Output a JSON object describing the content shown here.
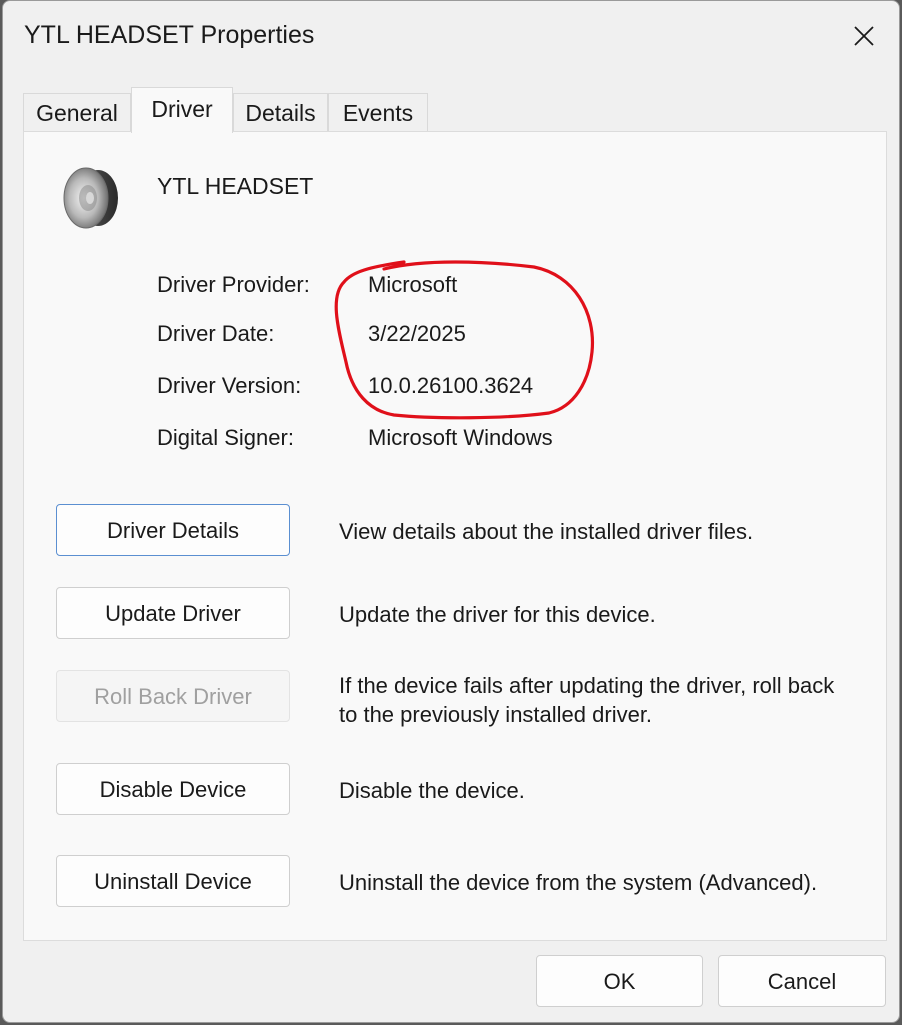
{
  "window": {
    "title": "YTL HEADSET Properties"
  },
  "tabs": [
    {
      "label": "General",
      "active": false
    },
    {
      "label": "Driver",
      "active": true
    },
    {
      "label": "Details",
      "active": false
    },
    {
      "label": "Events",
      "active": false
    }
  ],
  "device": {
    "name": "YTL HEADSET",
    "icon": "speaker-icon"
  },
  "driver_info": [
    {
      "label": "Driver Provider:",
      "value": "Microsoft"
    },
    {
      "label": "Driver Date:",
      "value": "3/22/2025"
    },
    {
      "label": "Driver Version:",
      "value": "10.0.26100.3624"
    },
    {
      "label": "Digital Signer:",
      "value": "Microsoft Windows"
    }
  ],
  "actions": [
    {
      "label": "Driver Details",
      "description": "View details about the installed driver files.",
      "enabled": true
    },
    {
      "label": "Update Driver",
      "description": "Update the driver for this device.",
      "enabled": true
    },
    {
      "label": "Roll Back Driver",
      "description": "If the device fails after updating the driver, roll back to the previously installed driver.",
      "enabled": false
    },
    {
      "label": "Disable Device",
      "description": "Disable the device.",
      "enabled": true
    },
    {
      "label": "Uninstall Device",
      "description": "Uninstall the device from the system (Advanced).",
      "enabled": true
    }
  ],
  "footer": {
    "ok_label": "OK",
    "cancel_label": "Cancel"
  },
  "annotation": {
    "color": "#e0101a"
  }
}
